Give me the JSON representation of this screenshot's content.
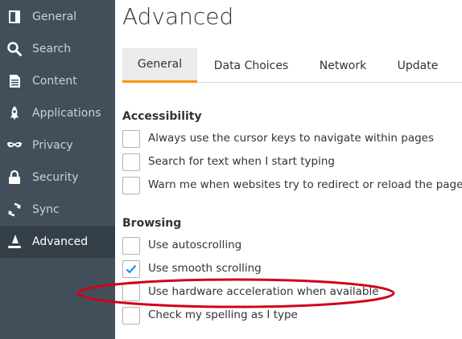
{
  "sidebar": {
    "items": [
      {
        "label": "General",
        "icon": "general-icon"
      },
      {
        "label": "Search",
        "icon": "search-icon"
      },
      {
        "label": "Content",
        "icon": "content-icon"
      },
      {
        "label": "Applications",
        "icon": "applications-icon"
      },
      {
        "label": "Privacy",
        "icon": "privacy-mask-icon"
      },
      {
        "label": "Security",
        "icon": "security-lock-icon"
      },
      {
        "label": "Sync",
        "icon": "sync-icon"
      },
      {
        "label": "Advanced",
        "icon": "advanced-wizard-icon"
      }
    ],
    "selected": "Advanced"
  },
  "main": {
    "title": "Advanced",
    "tabs": [
      {
        "label": "General"
      },
      {
        "label": "Data Choices"
      },
      {
        "label": "Network"
      },
      {
        "label": "Update"
      }
    ],
    "selected_tab": "General",
    "accessibility": {
      "heading": "Accessibility",
      "options": [
        {
          "label": "Always use the cursor keys to navigate within pages",
          "checked": false
        },
        {
          "label": "Search for text when I start typing",
          "checked": false
        },
        {
          "label": "Warn me when websites try to redirect or reload the page",
          "checked": false
        }
      ]
    },
    "browsing": {
      "heading": "Browsing",
      "options": [
        {
          "label": "Use autoscrolling",
          "checked": false
        },
        {
          "label": "Use smooth scrolling",
          "checked": true
        },
        {
          "label": "Use hardware acceleration when available",
          "checked": false
        },
        {
          "label": "Check my spelling as I type",
          "checked": false
        }
      ]
    }
  },
  "colors": {
    "sidebar_bg": "#424f5a",
    "sidebar_selected_bg": "#343f48",
    "tab_accent": "#ff9500",
    "check_accent": "#0a84ff",
    "annotation": "#d0021b"
  }
}
